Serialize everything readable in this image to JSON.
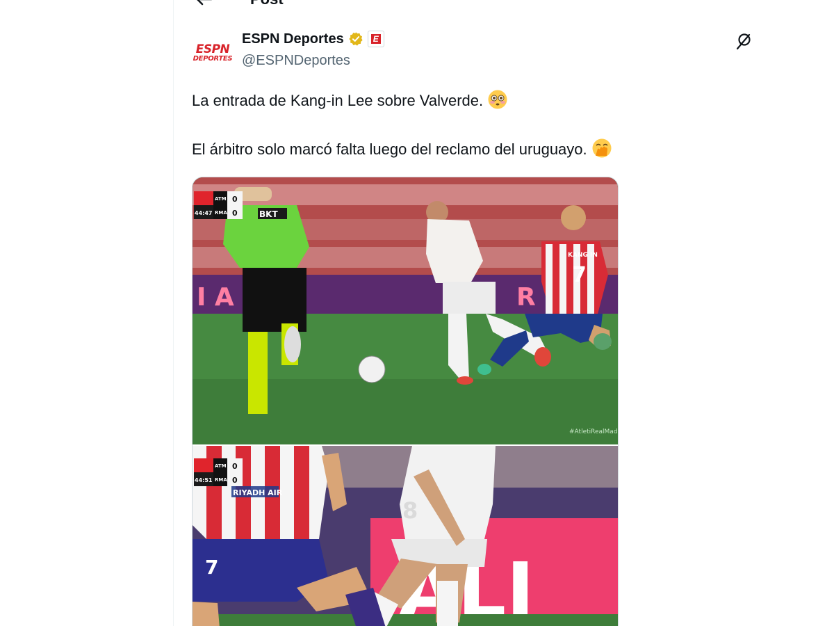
{
  "topbar": {
    "title": "Post"
  },
  "author": {
    "display_name": "ESPN Deportes",
    "handle": "@ESPNDeportes",
    "avatar_logo_top": "ESPN",
    "avatar_logo_bottom": "DEPORTES",
    "affiliate_badge": "E"
  },
  "tweet": {
    "line1": "La entrada de Kang-in Lee sobre Valverde.",
    "line2": "El árbitro solo marcó falta luego del reclamo del uruguayo.",
    "emoji1": "flushed-face-emoji",
    "emoji2": "face-with-hand-over-mouth-emoji"
  },
  "media": {
    "frame1": {
      "score": {
        "home_abbr": "ATM",
        "away_abbr": "RMA",
        "home_score": "0",
        "away_score": "0",
        "clock": "44:47"
      },
      "referee_sponsor": "BKT",
      "player_shirt_name": "KANG IN",
      "player_number": "7",
      "watermark": "#AtletiRealMad"
    },
    "frame2": {
      "score": {
        "home_abbr": "ATM",
        "away_abbr": "RMA",
        "home_score": "0",
        "away_score": "0",
        "clock": "44:51"
      },
      "sponsor": "RIYADH AIR",
      "player_number": "7",
      "rival_number": "8",
      "board_text": "ALI"
    }
  },
  "colors": {
    "accent": "#1d9bf0",
    "espn_red": "#d8232a",
    "text_secondary": "#536471",
    "verified_gold": "#e2b719"
  }
}
